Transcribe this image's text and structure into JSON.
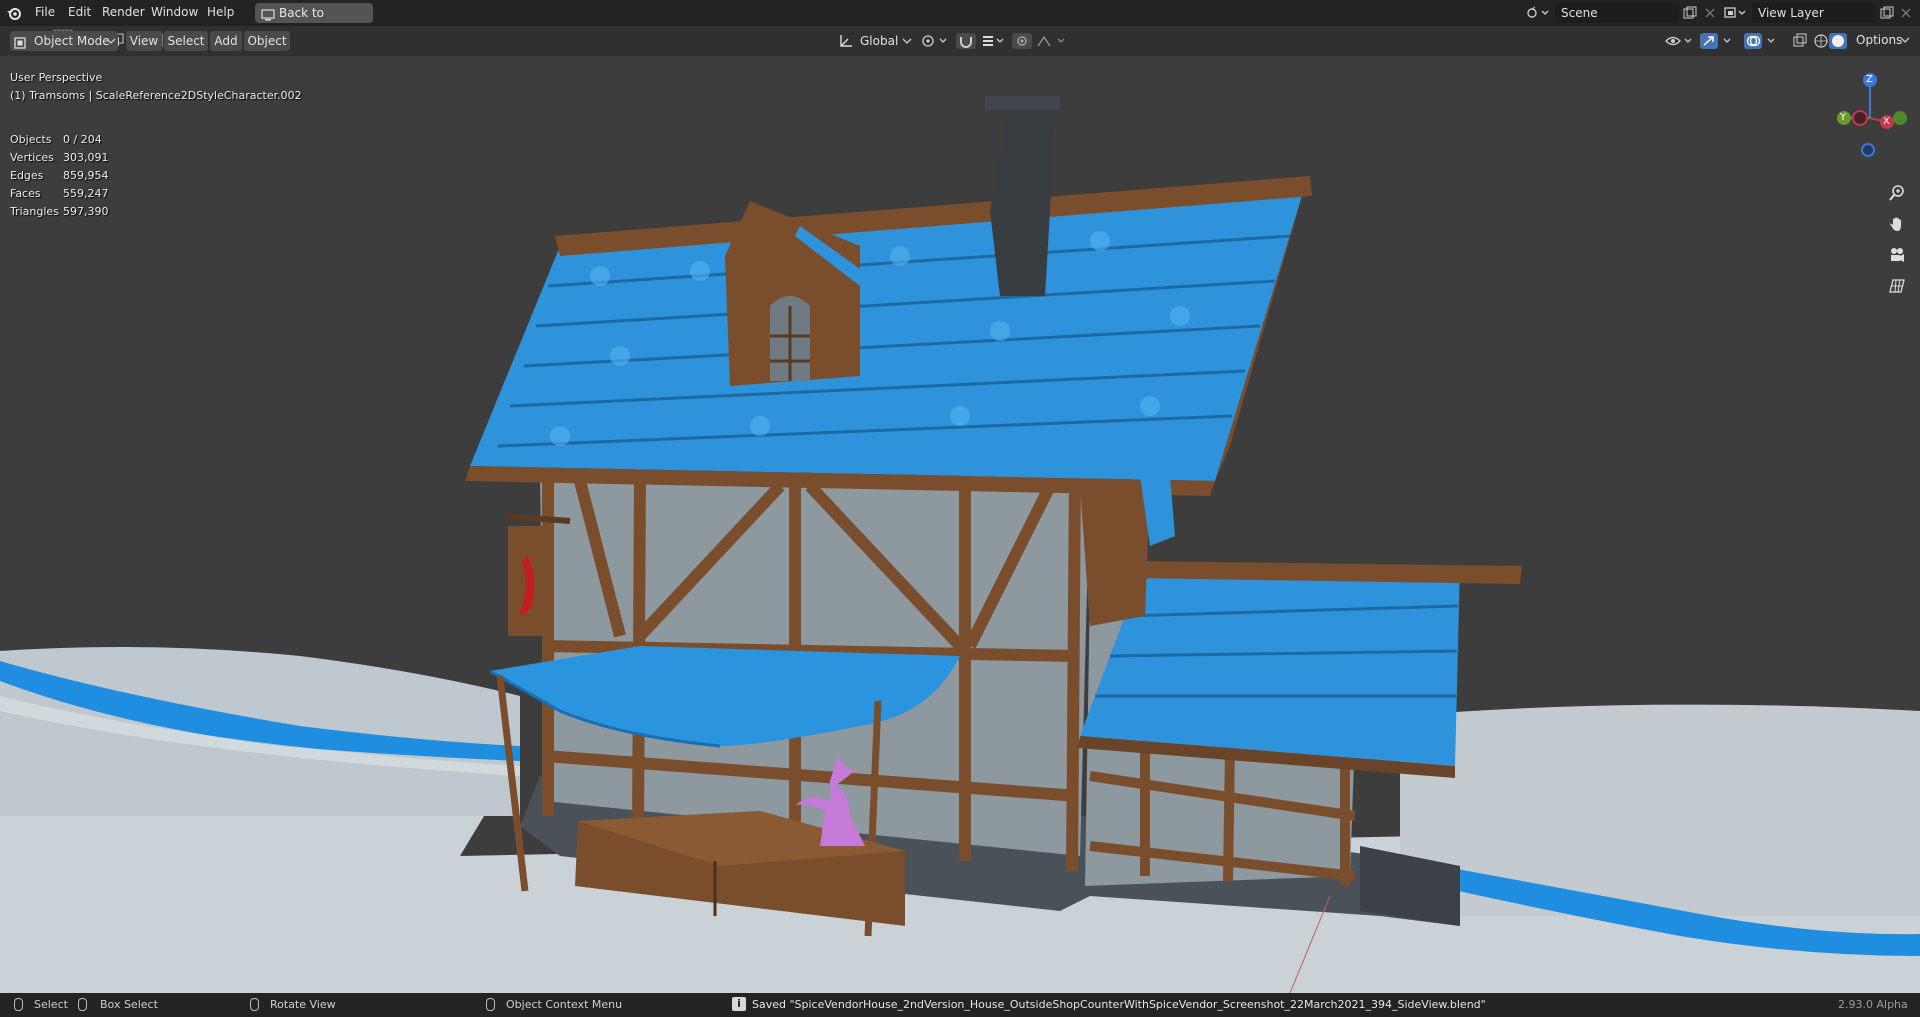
{
  "menu": {
    "items": [
      "File",
      "Edit",
      "Render",
      "Window",
      "Help"
    ],
    "back_button": "Back to Previous"
  },
  "top_right": {
    "scene_label": "Scene",
    "view_layer_label": "View Layer",
    "options_label": "Options"
  },
  "header": {
    "mode": "Object Mode",
    "menus": [
      "View",
      "Select",
      "Add",
      "Object"
    ],
    "orientation": "Global"
  },
  "viewport": {
    "perspective": "User Perspective",
    "active_object": "(1) Tramsoms | ScaleReference2DStyleCharacter.002",
    "stats": [
      {
        "label": "Objects",
        "value": "0 / 204"
      },
      {
        "label": "Vertices",
        "value": "303,091"
      },
      {
        "label": "Edges",
        "value": "859,954"
      },
      {
        "label": "Faces",
        "value": "559,247"
      },
      {
        "label": "Triangles",
        "value": "597,390"
      }
    ],
    "gizmo": {
      "z": "Z",
      "y": "Y",
      "x": "X"
    },
    "colors": {
      "background": "#3d3d3d",
      "roof": "#2e93db",
      "timber": "#7a4e2d",
      "wall": "#8e989f",
      "snow": "#c9d1d6",
      "river": "#1f8ee0",
      "character": "#c47ad6"
    }
  },
  "status": {
    "select": "Select",
    "box_select": "Box Select",
    "rotate_view": "Rotate View",
    "context_menu": "Object Context Menu",
    "saved_message": "Saved \"SpiceVendorHouse_2ndVersion_House_OutsideShopCounterWithSpiceVendor_Screenshot_22March2021_394_SideView.blend\"",
    "version": "2.93.0 Alpha"
  }
}
